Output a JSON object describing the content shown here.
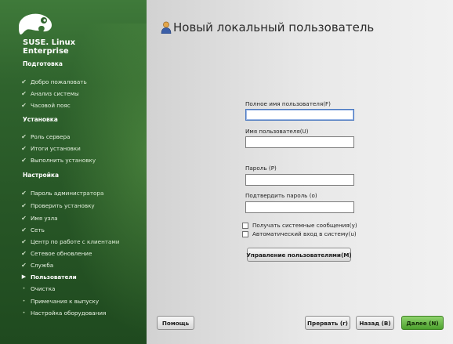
{
  "brand": {
    "line1": "SUSE. Linux",
    "line2": "Enterprise"
  },
  "sidebar": {
    "sections": [
      {
        "label": "Подготовка"
      },
      {
        "label": "Установка"
      },
      {
        "label": "Настройка"
      }
    ],
    "steps": [
      {
        "label": "Добро пожаловать",
        "state": "done"
      },
      {
        "label": "Анализ системы",
        "state": "done"
      },
      {
        "label": "Часовой пояс",
        "state": "done"
      },
      {
        "label": "Роль сервера",
        "state": "done"
      },
      {
        "label": "Итоги установки",
        "state": "done"
      },
      {
        "label": "Выполнить установку",
        "state": "done"
      },
      {
        "label": "Пароль администратора",
        "state": "done"
      },
      {
        "label": "Проверить установку",
        "state": "done"
      },
      {
        "label": "Имя узла",
        "state": "done"
      },
      {
        "label": "Сеть",
        "state": "done"
      },
      {
        "label": "Центр по работе с клиентами",
        "state": "done"
      },
      {
        "label": "Сетевое обновление",
        "state": "done"
      },
      {
        "label": "Служба",
        "state": "done"
      },
      {
        "label": "Пользователи",
        "state": "current"
      },
      {
        "label": "Очистка",
        "state": "pending"
      },
      {
        "label": "Примечания к выпуску",
        "state": "pending"
      },
      {
        "label": "Настройка оборудования",
        "state": "pending"
      }
    ],
    "marks": {
      "done": "✔",
      "current": "▶",
      "pending": "•"
    }
  },
  "main": {
    "title": "Новый локальный пользователь",
    "fields": {
      "full_name": {
        "label": "Полное имя пользователя(F)",
        "value": ""
      },
      "username": {
        "label": "Имя пользователя(U)",
        "value": ""
      },
      "password": {
        "label": "Пароль (P)",
        "value": ""
      },
      "confirm": {
        "label": "Подтвердить пароль (o)",
        "value": ""
      }
    },
    "checkboxes": {
      "system_mail": {
        "label": "Получать системные сообщения(y)",
        "checked": false
      },
      "autologin": {
        "label": "Автоматический вход в систему(u)",
        "checked": false
      }
    },
    "manage_users_button": "Управление пользователями(M)"
  },
  "buttons": {
    "help": "Помощь",
    "abort": "Прервать (r)",
    "back": "Назад (B)",
    "next": "Далее (N)"
  },
  "colors": {
    "sidebar": "#2f632d",
    "next": "#5fb33c",
    "focus": "#4a78c0"
  }
}
